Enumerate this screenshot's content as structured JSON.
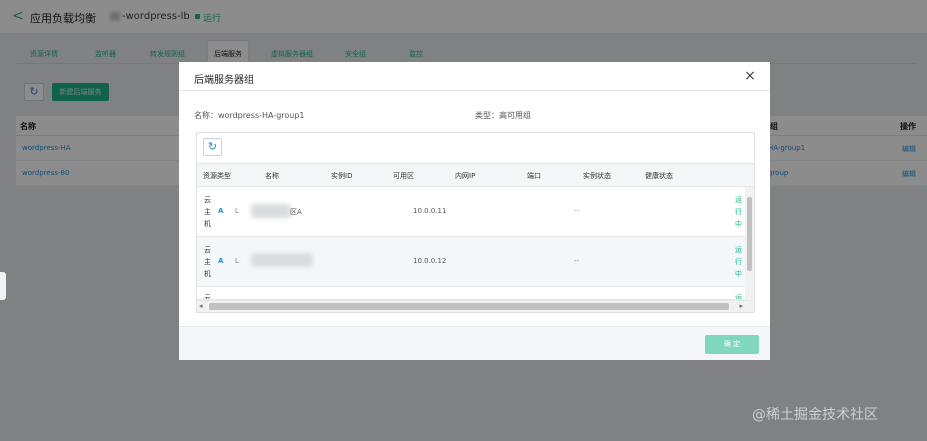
{
  "app": {
    "title": "应用负载均衡",
    "subtitle": "-wordpress-lb",
    "status": "运行"
  },
  "tabs": [
    {
      "label": "资源详情",
      "active": false
    },
    {
      "label": "监听器",
      "active": false
    },
    {
      "label": "转发规则组",
      "active": false
    },
    {
      "label": "后端服务",
      "active": true
    },
    {
      "label": "虚拟服务器组",
      "active": false
    },
    {
      "label": "安全组",
      "active": false
    },
    {
      "label": "监控",
      "active": false
    }
  ],
  "toolbar": {
    "add_label": "新建后端服务"
  },
  "bg_table": {
    "col_name": "名称",
    "col_group": "组",
    "col_ops": "操作",
    "rows": [
      {
        "name": "wordpress-HA",
        "group": "HA-group1",
        "op": "编辑"
      },
      {
        "name": "wordpress-80",
        "group": "group",
        "op": "编辑"
      }
    ]
  },
  "modal": {
    "title": "后端服务器组",
    "close_glyph": "×",
    "name_label": "名称：wordpress-HA-group1",
    "type_label": "类型：高可用组",
    "columns": [
      "资源类型",
      "名称",
      "实例ID",
      "可用区",
      "内网IP",
      "端口",
      "实例状态",
      "健康状态"
    ],
    "rows": [
      {
        "type_chars": [
          "云",
          "主",
          "机"
        ],
        "a": "A",
        "l": "L",
        "zone": "区A",
        "ip": "10.0.0.11",
        "dash": "--",
        "status_chars": [
          "运",
          "行",
          "中"
        ]
      },
      {
        "type_chars": [
          "云",
          "主",
          "机"
        ],
        "a": "A",
        "l": "L",
        "zone": "",
        "ip": "10.0.0.12",
        "dash": "--",
        "status_chars": [
          "运",
          "行",
          "中"
        ]
      },
      {
        "type_chars": [
          "云"
        ],
        "a": "",
        "l": "",
        "zone": "",
        "ip": "",
        "dash": "",
        "status_chars": [
          "运"
        ]
      }
    ],
    "ok_label": "确 定"
  },
  "icons": {
    "refresh": "↻",
    "back": "<",
    "scroll_left": "◂",
    "scroll_right": "▸"
  },
  "watermark": "@稀土掘金技术社区",
  "colors": {
    "accent": "#20b58a",
    "link": "#1f8fd8"
  }
}
